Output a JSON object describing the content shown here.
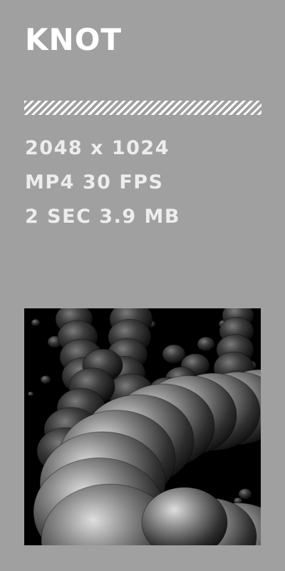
{
  "item": {
    "title": "KNOT",
    "specs": {
      "resolution": "2048 x 1024",
      "format": "MP4 30 FPS",
      "duration_size": "2 SEC 3.9 MB"
    },
    "thumbnail_alt": "KNOT"
  },
  "colors": {
    "background": "#a0a0a0",
    "title": "#ffffff",
    "specs_text": "#ededed",
    "thumbnail_bg": "#000000"
  }
}
